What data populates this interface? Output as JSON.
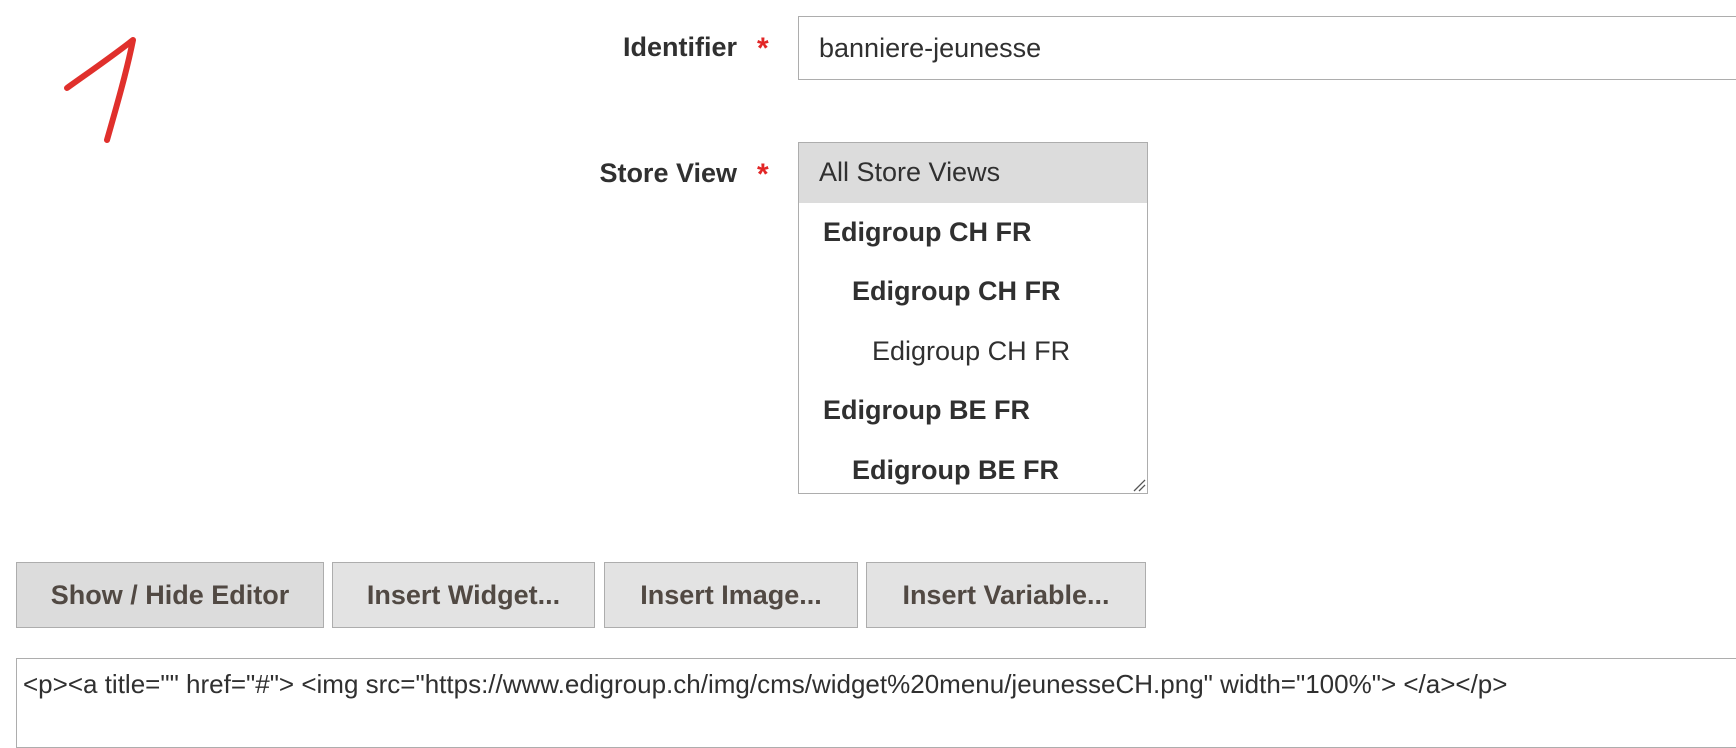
{
  "form": {
    "identifier": {
      "label": "Identifier",
      "required_mark": "*",
      "value": "banniere-jeunesse"
    },
    "store_view": {
      "label": "Store View",
      "required_mark": "*",
      "options": [
        {
          "label": "All Store Views",
          "level": "selected"
        },
        {
          "label": "Edigroup CH FR",
          "level": "group1"
        },
        {
          "label": "Edigroup CH FR",
          "level": "group2"
        },
        {
          "label": "Edigroup CH FR",
          "level": "leaf"
        },
        {
          "label": "Edigroup BE FR",
          "level": "group1"
        },
        {
          "label": "Edigroup BE FR",
          "level": "group2"
        }
      ]
    }
  },
  "toolbar": {
    "show_hide_label": "Show / Hide Editor",
    "insert_widget_label": "Insert Widget...",
    "insert_image_label": "Insert Image...",
    "insert_variable_label": "Insert Variable..."
  },
  "editor": {
    "content": "<p><a title=\"\" href=\"#\"> <img src=\"https://www.edigroup.ch/img/cms/widget%20menu/jeunesseCH.png\" width=\"100%\"> </a></p>"
  },
  "annotation": {
    "color": "#e0302c"
  },
  "colors": {
    "required": "#e22626",
    "selected_option_bg": "#dcdcdc",
    "button_bg": "#e3e3e3",
    "border": "#adadad"
  }
}
